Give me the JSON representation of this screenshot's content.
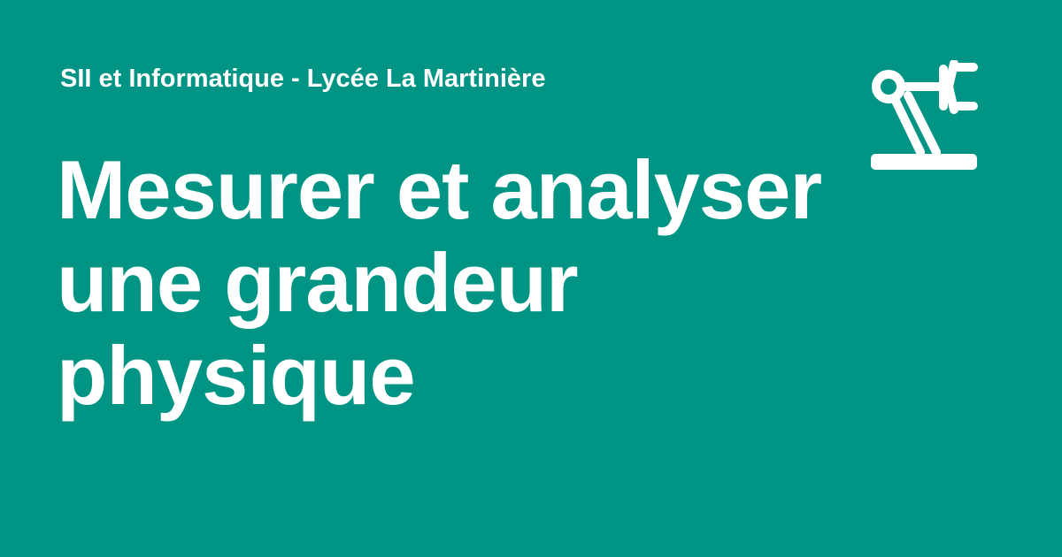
{
  "header": {
    "site_name": "SII et Informatique - Lycée La Martinière"
  },
  "main": {
    "title_lines": [
      "Mesurer et analyser",
      "une grandeur",
      "physique"
    ]
  },
  "logo": {
    "icon": "robot-arm-icon"
  },
  "colors": {
    "background": "#009485",
    "foreground": "#ffffff"
  }
}
